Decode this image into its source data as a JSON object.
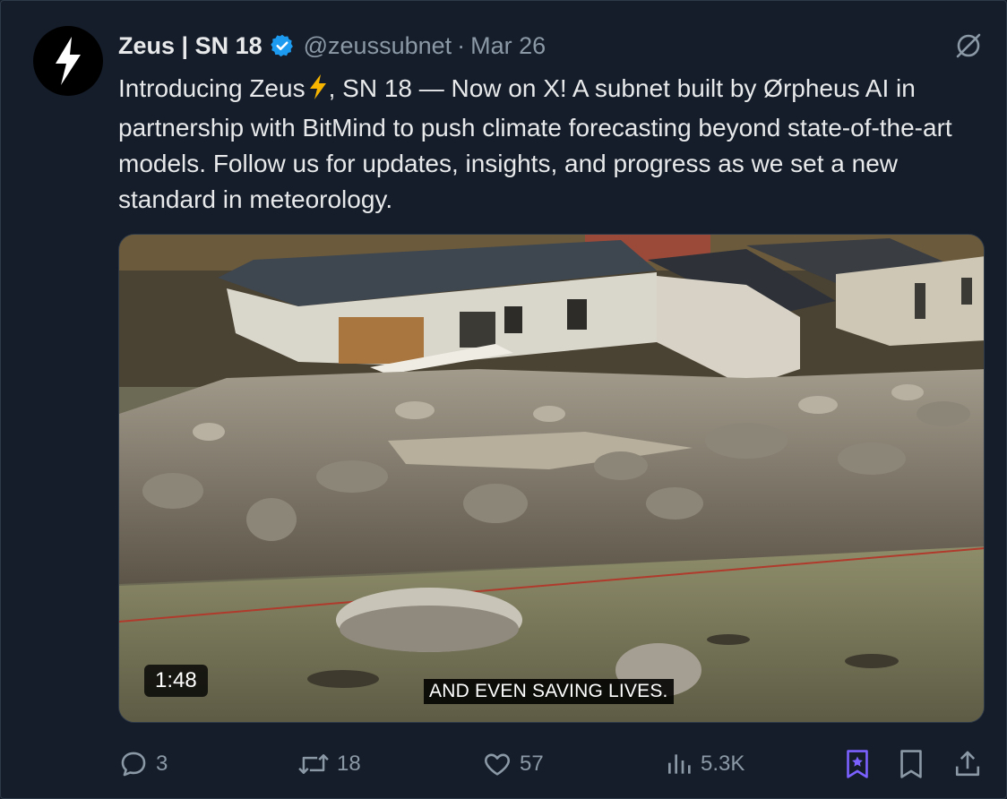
{
  "tweet": {
    "display_name": "Zeus | SN 18",
    "handle": "@zeussubnet",
    "separator": "·",
    "date": "Mar 26",
    "text_before_emoji": "Introducing Zeus",
    "text_after_emoji": ", SN 18 — Now on X! A subnet built by Ørpheus AI in partnership with BitMind to push climate forecasting beyond state-of-the-art models. Follow us for updates, insights, and progress as we set a new standard in meteorology."
  },
  "media": {
    "duration": "1:48",
    "caption": "AND EVEN SAVING LIVES."
  },
  "actions": {
    "replies": "3",
    "reposts": "18",
    "likes": "57",
    "views": "5.3K"
  },
  "colors": {
    "background": "#151d2a",
    "text": "#e7e9ea",
    "muted": "#8b98a5",
    "verified": "#1d9bf0",
    "grok_accent": "#7b61ff"
  },
  "icons": {
    "avatar": "lightning-bolt-logo",
    "verified": "verified-badge-icon",
    "emoji": "high-voltage-emoji",
    "grok": "grok-icon",
    "reply": "reply-icon",
    "retweet": "repost-icon",
    "like": "heart-icon",
    "views": "views-icon",
    "grok_action": "grok-bookmark-icon",
    "bookmark": "bookmark-icon",
    "share": "share-icon"
  }
}
